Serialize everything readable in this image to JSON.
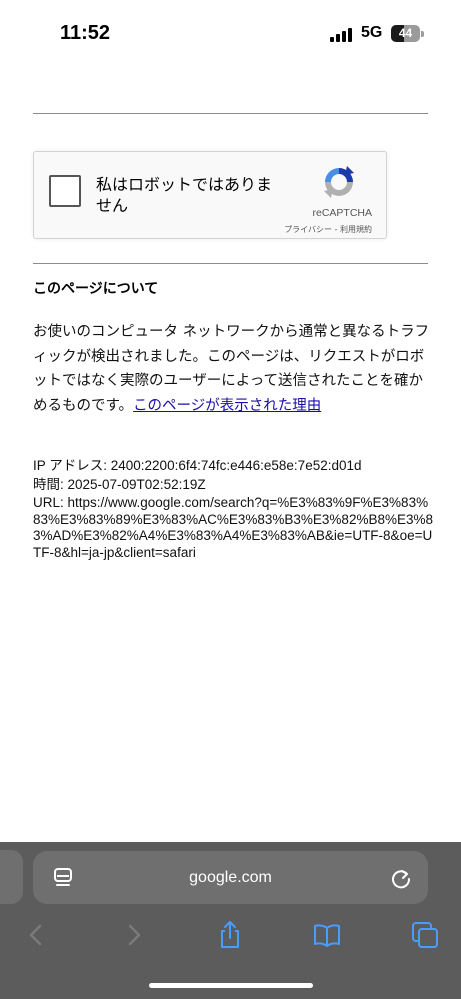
{
  "status_bar": {
    "time": "11:52",
    "network": "5G",
    "battery_level": "44",
    "battery_fraction": 0.44
  },
  "captcha": {
    "checkbox_label": "私はロボットではありません",
    "brand": "reCAPTCHA",
    "links": "プライバシー - 利用規約"
  },
  "about": {
    "title": "このページについて",
    "body": "お使いのコンピュータ ネットワークから通常と異なるトラフィックが検出されました。このページは、リクエストがロボットではなく実際のユーザーによって送信されたことを確かめるものです。",
    "link": "このページが表示された理由"
  },
  "info": {
    "ip": "IP アドレス: 2400:2200:6f4:74fc:e446:e58e:7e52:d01d",
    "time": "時間: 2025-07-09T02:52:19Z",
    "url": "URL: https://www.google.com/search?q=%E3%83%9F%E3%83%83%E3%83%89%E3%83%AC%E3%83%B3%E3%82%B8%E3%83%AD%E3%82%A4%E3%83%A4%E3%83%AB&ie=UTF-8&oe=UTF-8&hl=ja-jp&client=safari"
  },
  "browser": {
    "address": "google.com"
  },
  "colors": {
    "link": "#1a0dab",
    "toolbar_icon": "#4a9cff",
    "toolbar_bg": "#5c5c5c"
  },
  "icons": [
    "page-menu-icon",
    "reload-icon",
    "back-icon",
    "forward-icon",
    "share-icon",
    "bookmarks-icon",
    "tabs-icon",
    "recaptcha-logo-icon"
  ]
}
